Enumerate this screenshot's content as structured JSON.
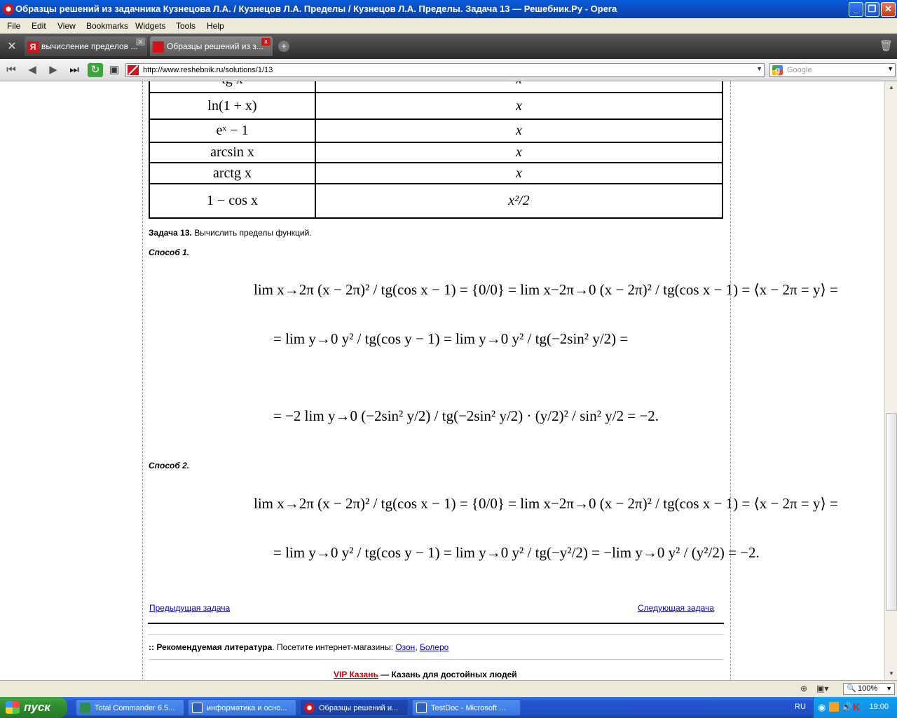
{
  "window": {
    "title": "Образцы решений из задачника Кузнецова Л.А. / Кузнецов Л.А. Пределы / Кузнецов Л.А. Пределы. Задача 13 — Решебник.Ру - Opera"
  },
  "menu": [
    "File",
    "Edit",
    "View",
    "Bookmarks",
    "Widgets",
    "Tools",
    "Help"
  ],
  "tabs": [
    {
      "label": "вычисление пределов ...",
      "close": "x"
    },
    {
      "label": "Образцы решений из з...",
      "close": "x"
    }
  ],
  "address": {
    "url": "http://www.reshebnik.ru/solutions/1/13"
  },
  "search": {
    "placeholder": "Google"
  },
  "table": {
    "rows": [
      {
        "left": "tg x",
        "right": "x"
      },
      {
        "left": "ln(1 + x)",
        "right": "x"
      },
      {
        "left": "eˣ − 1",
        "right": "x"
      },
      {
        "left": "arcsin x",
        "right": "x"
      },
      {
        "left": "arctg x",
        "right": "x"
      },
      {
        "left": "1 − cos x",
        "right": "x²/2"
      }
    ]
  },
  "task": {
    "number_label": "Задача 13.",
    "text": "Вычислить пределы функций.",
    "method1": "Способ 1.",
    "method2": "Способ 2."
  },
  "formulas": {
    "m1_line1": "lim x→2π (x − 2π)² / tg(cos x − 1) = {0/0} = lim x−2π→0 (x − 2π)² / tg(cos x − 1) = ⟨x − 2π = y⟩ =",
    "m1_line2": "= lim y→0 y² / tg(cos y − 1) = lim y→0 y² / tg(−2sin² y/2) =",
    "m1_line3": "= −2 lim y→0 (−2sin² y/2) / tg(−2sin² y/2) · (y/2)² / sin² y/2 = −2.",
    "m2_line1": "lim x→2π (x − 2π)² / tg(cos x − 1) = {0/0} = lim x−2π→0 (x − 2π)² / tg(cos x − 1) = ⟨x − 2π = y⟩ =",
    "m2_line2": "= lim y→0 y² / tg(cos y − 1) = lim y→0 y² / tg(−y²/2) = −lim y→0 y² / (y²/2) = −2."
  },
  "nav": {
    "prev": "Предыдущая задача",
    "next": "Следующая задача"
  },
  "literature": {
    "prefix": "::",
    "title": "Рекомендуемая литература",
    "text": ". Посетите интернет-магазины:",
    "shop1": "Озон",
    "sep": ",",
    "shop2": "Болеро"
  },
  "promo": {
    "link": "VIP Казань",
    "text": "— Казань для достойных людей"
  },
  "status": {
    "zoom": "100%"
  },
  "taskbar": {
    "start": "пуск",
    "tasks": [
      {
        "label": "Total Commander 6.5..."
      },
      {
        "label": "информатика и осно..."
      },
      {
        "label": "Образцы решений и..."
      },
      {
        "label": "TestDoc - Microsoft ..."
      }
    ],
    "lang": "RU",
    "clock": "19:00"
  },
  "colors": {
    "title_blue": "#0b4fc4",
    "link": "#0000cc",
    "promo_red": "#cc0000",
    "taskbar_blue": "#2458d2"
  }
}
